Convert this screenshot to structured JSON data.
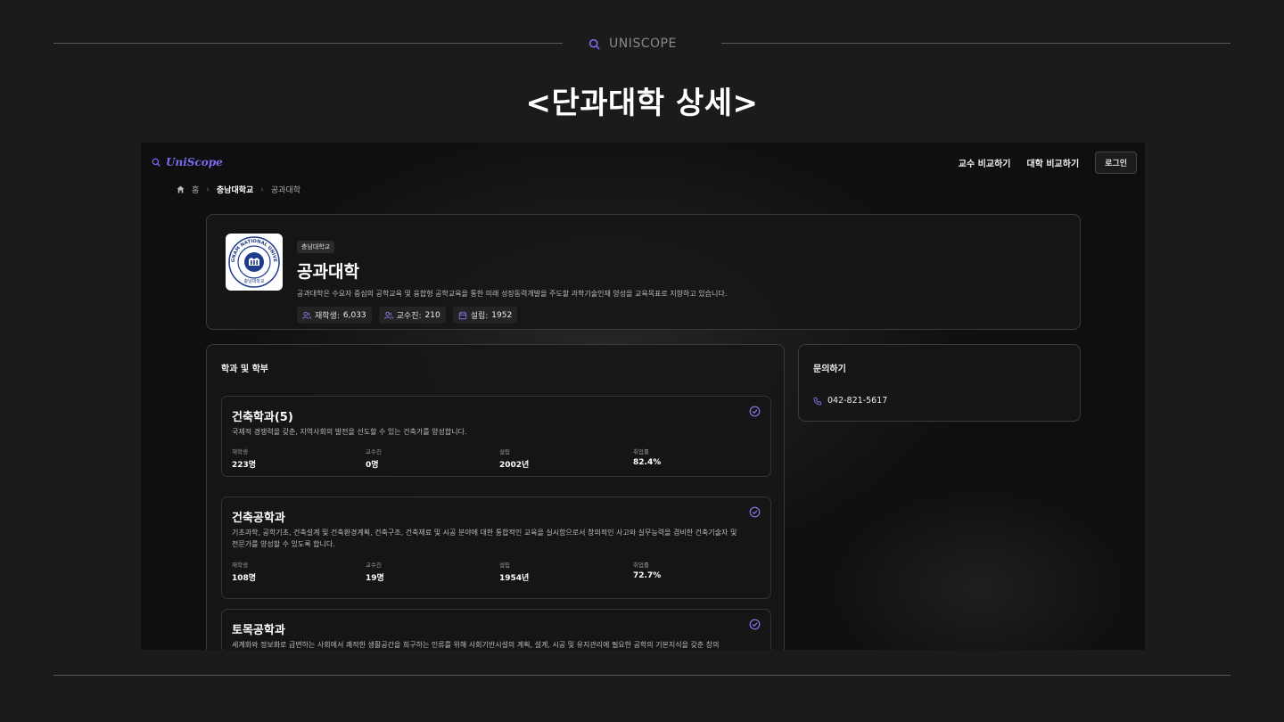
{
  "slide": {
    "brand": "UNISCOPE",
    "heading": "<단과대학 상세>"
  },
  "app": {
    "logo": "UniScope",
    "nav": {
      "compare_professors": "교수 비교하기",
      "compare_universities": "대학 비교하기",
      "login": "로그인"
    },
    "breadcrumb": {
      "home": "홈",
      "university": "충남대학교",
      "college": "공과대학"
    },
    "college": {
      "university_tag": "충남대학교",
      "name": "공과대학",
      "description": "공과대학은 수요자 중심의 공학교육 및 융합형 공학교육을 통한 미래 성장동력개발을 주도할 과학기술인재 양성을 교육목표로 지향하고 있습니다.",
      "seal_text_top": "CHUNGNAM NATIONAL UNIVERSITY",
      "seal_text_bottom": "충남대학교",
      "stats": {
        "students_label": "재학생:",
        "students_value": "6,033",
        "faculty_label": "교수진:",
        "faculty_value": "210",
        "founded_label": "설립:",
        "founded_value": "1952"
      }
    },
    "departments_section": {
      "title": "학과 및 학부",
      "metric_labels": [
        "재학생",
        "교수진",
        "설립",
        "취업률"
      ],
      "items": [
        {
          "name": "건축학과(5)",
          "description": "국제적 경쟁력을 갖춘, 지역사회의 발전을 선도할 수 있는 건축가를 양성합니다.",
          "students": "223명",
          "faculty": "0명",
          "founded": "2002년",
          "employment": "82.4%"
        },
        {
          "name": "건축공학과",
          "description": "기초과학, 공학기초, 건축설계 및 건축환경계획, 건축구조, 건축재료 및 시공 분야에 대한 통합적인 교육을 실시함으로서 창의적인 사고와 실무능력을 겸비한 건축기술자 및 전문가를 양성할 수 있도록 합니다.",
          "students": "108명",
          "faculty": "19명",
          "founded": "1954년",
          "employment": "72.7%"
        },
        {
          "name": "토목공학과",
          "description": "세계화와 정보화로 급변하는 사회에서 쾌적한 생활공간을 희구하는 인류를 위해 사회기반시설의 계획, 설계, 시공 및 유지관리에 필요한 공학의 기본지식을 갖춘 창의"
        }
      ]
    },
    "contact": {
      "title": "문의하기",
      "phone": "042-821-5617"
    }
  },
  "colors": {
    "accent": "#7a6cf0",
    "background": "#1b1b1b"
  }
}
